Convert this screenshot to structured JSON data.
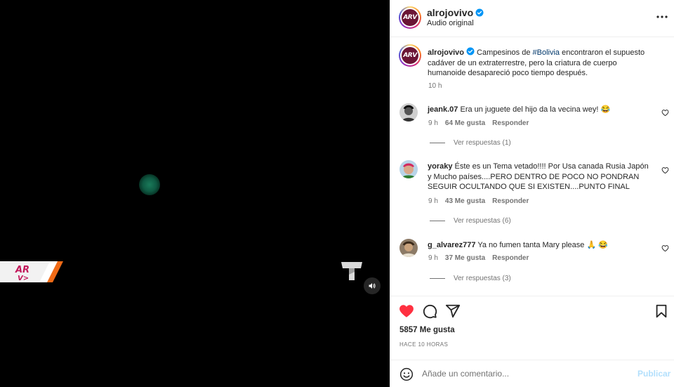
{
  "video": {
    "channel_logo_text": "ARV",
    "network_logo": "telemundo-t-logo",
    "mute_icon": "speaker-icon"
  },
  "header": {
    "username": "alrojovivo",
    "subtitle": "Audio original",
    "avatar_text": "ARV"
  },
  "caption": {
    "username": "alrojovivo",
    "text_before": " Campesinos de ",
    "hashtag": "#Bolivia",
    "text_after": " encontraron el supuesto cadáver de un extraterrestre, pero la criatura de cuerpo humanoide desapareció poco tiempo después.",
    "time": "10 h"
  },
  "comments": [
    {
      "username": "jeank.07",
      "text": " Era un juguete del hijo da la vecina wey! 😂",
      "time": "9 h",
      "likes": "64 Me gusta",
      "reply": "Responder",
      "view_replies": "Ver respuestas (1)"
    },
    {
      "username": "yoraky",
      "text": " Éste es un Tema vetado!!!! Por Usa canada Rusia Japón y Mucho países....PERO DENTRO DE POCO NO PONDRAN SEGUIR OCULTANDO QUE SI EXISTEN....PUNTO FINAL",
      "time": "9 h",
      "likes": "43 Me gusta",
      "reply": "Responder",
      "view_replies": "Ver respuestas (6)"
    },
    {
      "username": "g_alvarez777",
      "text": " Ya no fumen tanta Mary please 🙏 😂",
      "time": "9 h",
      "likes": "37 Me gusta",
      "reply": "Responder",
      "view_replies": "Ver respuestas (3)"
    }
  ],
  "likes_count": "5857 Me gusta",
  "time_ago": "HACE 10 HORAS",
  "add_comment": {
    "placeholder": "Añade un comentario...",
    "publish_label": "Publicar"
  },
  "colors": {
    "like_red": "#ff3040",
    "link_blue": "#00376b",
    "verified_blue": "#0095f6",
    "publish_disabled": "#b2dffc"
  }
}
